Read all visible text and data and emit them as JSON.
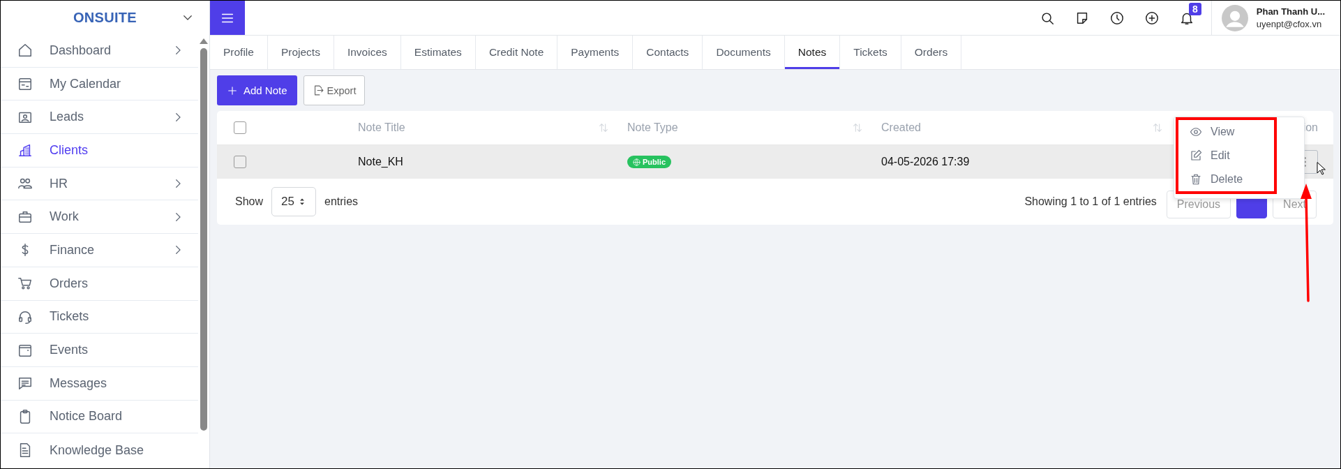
{
  "brand": "ONSUITE",
  "sidebar": {
    "items": [
      {
        "label": "Dashboard",
        "has_submenu": true,
        "selected": false
      },
      {
        "label": "My Calendar",
        "has_submenu": false,
        "selected": false
      },
      {
        "label": "Leads",
        "has_submenu": true,
        "selected": false
      },
      {
        "label": "Clients",
        "has_submenu": false,
        "selected": true
      },
      {
        "label": "HR",
        "has_submenu": true,
        "selected": false
      },
      {
        "label": "Work",
        "has_submenu": true,
        "selected": false
      },
      {
        "label": "Finance",
        "has_submenu": true,
        "selected": false
      },
      {
        "label": "Orders",
        "has_submenu": false,
        "selected": false
      },
      {
        "label": "Tickets",
        "has_submenu": false,
        "selected": false
      },
      {
        "label": "Events",
        "has_submenu": false,
        "selected": false
      },
      {
        "label": "Messages",
        "has_submenu": false,
        "selected": false
      },
      {
        "label": "Notice Board",
        "has_submenu": false,
        "selected": false
      },
      {
        "label": "Knowledge Base",
        "has_submenu": false,
        "selected": false
      }
    ]
  },
  "header": {
    "notification_count": "8",
    "user": {
      "name": "Phan Thanh U...",
      "email": "uyenpt@cfox.vn"
    }
  },
  "tabs": [
    {
      "label": "Profile",
      "selected": false
    },
    {
      "label": "Projects",
      "selected": false
    },
    {
      "label": "Invoices",
      "selected": false
    },
    {
      "label": "Estimates",
      "selected": false
    },
    {
      "label": "Credit Note",
      "selected": false
    },
    {
      "label": "Payments",
      "selected": false
    },
    {
      "label": "Contacts",
      "selected": false
    },
    {
      "label": "Documents",
      "selected": false
    },
    {
      "label": "Notes",
      "selected": true
    },
    {
      "label": "Tickets",
      "selected": false
    },
    {
      "label": "Orders",
      "selected": false
    }
  ],
  "toolbar": {
    "add_button": "Add Note",
    "export_button": "Export"
  },
  "table": {
    "select_all_checked": false,
    "columns": [
      "Note Title",
      "Note Type",
      "Created",
      "ion"
    ],
    "rows": [
      {
        "checked": false,
        "title": "Note_KH",
        "type": "Public",
        "created": "04-05-2026 17:39"
      }
    ]
  },
  "footer": {
    "show_label": "Show",
    "page_size": "25",
    "entries_label": "entries",
    "summary": "Showing 1 to 1 of 1 entries",
    "previous": "Previous",
    "page": {
      "selected": true
    },
    "next": "Next"
  },
  "action_menu": {
    "items": [
      {
        "kind": "view",
        "label": "View"
      },
      {
        "kind": "edit",
        "label": "Edit"
      },
      {
        "kind": "delete",
        "label": "Delete"
      }
    ]
  }
}
